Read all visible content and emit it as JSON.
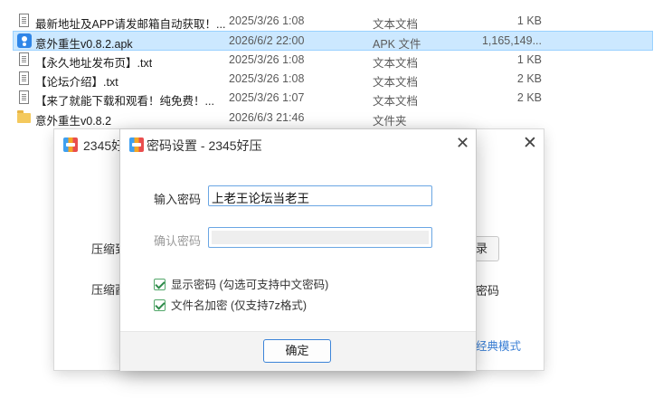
{
  "files": [
    {
      "name": "最新地址及APP请发邮箱自动获取！...",
      "date": "2025/3/26 1:08",
      "type": "文本文档",
      "size": "1 KB",
      "icon": "txt",
      "selected": false
    },
    {
      "name": "意外重生v0.8.2.apk",
      "date": "2026/6/2 22:00",
      "type": "APK 文件",
      "size": "1,165,149...",
      "icon": "apk",
      "selected": true
    },
    {
      "name": "【永久地址发布页】.txt",
      "date": "2025/3/26 1:08",
      "type": "文本文档",
      "size": "1 KB",
      "icon": "txt",
      "selected": false
    },
    {
      "name": "【论坛介绍】.txt",
      "date": "2025/3/26 1:08",
      "type": "文本文档",
      "size": "2 KB",
      "icon": "txt",
      "selected": false
    },
    {
      "name": "【来了就能下载和观看！纯免费！...",
      "date": "2025/3/26 1:07",
      "type": "文本文档",
      "size": "2 KB",
      "icon": "txt",
      "selected": false
    },
    {
      "name": "意外重生v0.8.2",
      "date": "2026/6/3 21:46",
      "type": "文件夹",
      "size": "",
      "icon": "folder",
      "selected": false
    }
  ],
  "bg_window": {
    "title": "2345好",
    "label_1": "压缩到",
    "label_2": "压缩酉",
    "button_partial": "录",
    "label_right": "密码",
    "link": "经典模式"
  },
  "dialog": {
    "title": "密码设置 - 2345好压",
    "close_glyph": "✕",
    "password_label": "输入密码",
    "password_value": "上老王论坛当老王",
    "confirm_label": "确认密码",
    "show_password": "显示密码 (勾选可支持中文密码)",
    "encrypt_filenames": "文件名加密 (仅支持7z格式)",
    "ok_label": "确定"
  },
  "icons": {
    "txt": "text-file-icon",
    "apk": "apk-file-icon",
    "folder": "folder-icon",
    "logo": "2345-haozip-logo-icon",
    "check": "checkbox-checked-icon"
  },
  "colors": {
    "selection_bg": "#cce8ff",
    "selection_border": "#99d1ff",
    "input_border": "#6aa6e3",
    "ok_border": "#3c84d8",
    "link": "#3a7fd5",
    "check": "#2e8b4a"
  }
}
